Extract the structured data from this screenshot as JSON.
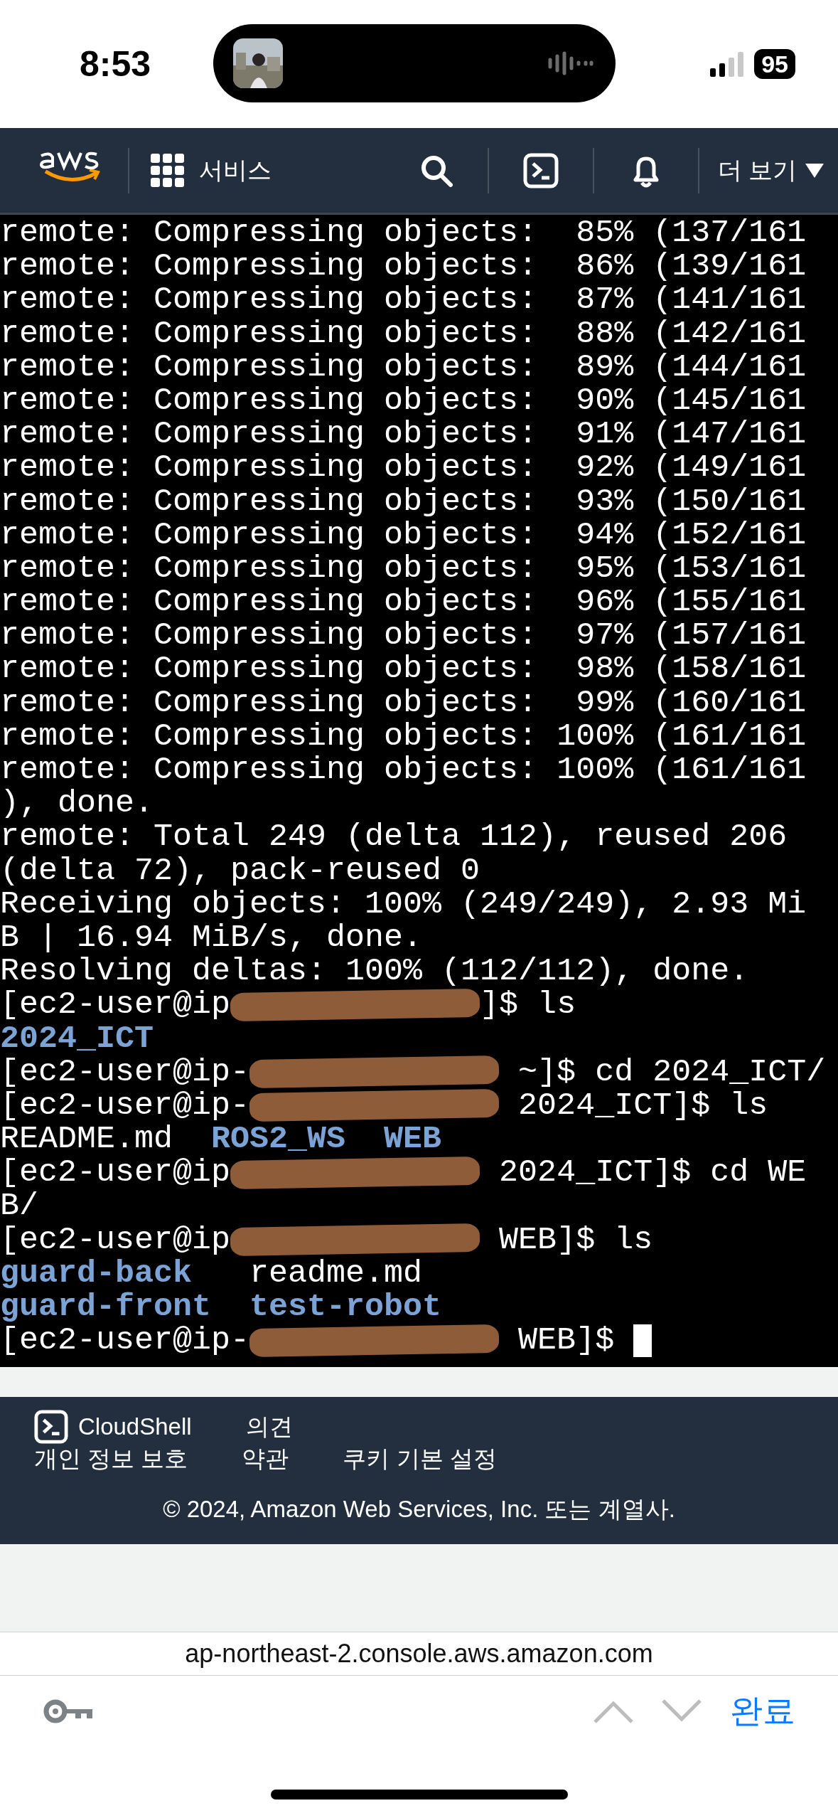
{
  "status_bar": {
    "time": "8:53",
    "battery": "95"
  },
  "nav": {
    "services": "서비스",
    "more": "더 보기"
  },
  "terminal": {
    "lines": [
      [
        {
          "kind": "plain",
          "text": "remote: Compressing objects:  85% (137/161"
        }
      ],
      [
        {
          "kind": "plain",
          "text": "remote: Compressing objects:  86% (139/161"
        }
      ],
      [
        {
          "kind": "plain",
          "text": "remote: Compressing objects:  87% (141/161"
        }
      ],
      [
        {
          "kind": "plain",
          "text": "remote: Compressing objects:  88% (142/161"
        }
      ],
      [
        {
          "kind": "plain",
          "text": "remote: Compressing objects:  89% (144/161"
        }
      ],
      [
        {
          "kind": "plain",
          "text": "remote: Compressing objects:  90% (145/161"
        }
      ],
      [
        {
          "kind": "plain",
          "text": "remote: Compressing objects:  91% (147/161"
        }
      ],
      [
        {
          "kind": "plain",
          "text": "remote: Compressing objects:  92% (149/161"
        }
      ],
      [
        {
          "kind": "plain",
          "text": "remote: Compressing objects:  93% (150/161"
        }
      ],
      [
        {
          "kind": "plain",
          "text": "remote: Compressing objects:  94% (152/161"
        }
      ],
      [
        {
          "kind": "plain",
          "text": "remote: Compressing objects:  95% (153/161"
        }
      ],
      [
        {
          "kind": "plain",
          "text": "remote: Compressing objects:  96% (155/161"
        }
      ],
      [
        {
          "kind": "plain",
          "text": "remote: Compressing objects:  97% (157/161"
        }
      ],
      [
        {
          "kind": "plain",
          "text": "remote: Compressing objects:  98% (158/161"
        }
      ],
      [
        {
          "kind": "plain",
          "text": "remote: Compressing objects:  99% (160/161"
        }
      ],
      [
        {
          "kind": "plain",
          "text": "remote: Compressing objects: 100% (161/161"
        }
      ],
      [
        {
          "kind": "plain",
          "text": "remote: Compressing objects: 100% (161/161"
        }
      ],
      [
        {
          "kind": "plain",
          "text": "), done."
        }
      ],
      [
        {
          "kind": "plain",
          "text": "remote: Total 249 (delta 112), reused 206"
        }
      ],
      [
        {
          "kind": "plain",
          "text": "(delta 72), pack-reused 0"
        }
      ],
      [
        {
          "kind": "plain",
          "text": "Receiving objects: 100% (249/249), 2.93 Mi"
        }
      ],
      [
        {
          "kind": "plain",
          "text": "B | 16.94 MiB/s, done."
        }
      ],
      [
        {
          "kind": "plain",
          "text": "Resolving deltas: 100% (112/112), done."
        }
      ],
      [
        {
          "kind": "plain",
          "text": "[ec2-user@ip"
        },
        {
          "kind": "redaction"
        },
        {
          "kind": "plain",
          "text": "]$ ls"
        }
      ],
      [
        {
          "kind": "dir",
          "text": "2024_ICT"
        }
      ],
      [
        {
          "kind": "plain",
          "text": "[ec2-user@ip-"
        },
        {
          "kind": "redaction"
        },
        {
          "kind": "plain",
          "text": " ~]$ cd 2024_ICT/"
        }
      ],
      [
        {
          "kind": "plain",
          "text": "[ec2-user@ip-"
        },
        {
          "kind": "redaction"
        },
        {
          "kind": "plain",
          "text": " 2024_ICT]$ ls"
        }
      ],
      [
        {
          "kind": "plain",
          "text": "README.md  "
        },
        {
          "kind": "dir",
          "text": "ROS2_WS  "
        },
        {
          "kind": "dir",
          "text": "WEB"
        }
      ],
      [
        {
          "kind": "plain",
          "text": "[ec2-user@ip"
        },
        {
          "kind": "redaction"
        },
        {
          "kind": "plain",
          "text": " 2024_ICT]$ cd WE"
        }
      ],
      [
        {
          "kind": "plain",
          "text": "B/"
        }
      ],
      [
        {
          "kind": "plain",
          "text": "[ec2-user@ip"
        },
        {
          "kind": "redaction"
        },
        {
          "kind": "plain",
          "text": " WEB]$ ls"
        }
      ],
      [
        {
          "kind": "dir",
          "text": "guard-back"
        },
        {
          "kind": "plain",
          "text": "   readme.md"
        }
      ],
      [
        {
          "kind": "dir",
          "text": "guard-front  "
        },
        {
          "kind": "dir",
          "text": "test-robot"
        }
      ],
      [
        {
          "kind": "plain",
          "text": "[ec2-user@ip-"
        },
        {
          "kind": "redaction"
        },
        {
          "kind": "plain",
          "text": " WEB]$ "
        },
        {
          "kind": "cursor"
        }
      ]
    ]
  },
  "footer": {
    "cloudshell": "CloudShell",
    "feedback": "의견",
    "links": [
      "개인 정보 보호",
      "약관",
      "쿠키 기본 설정"
    ],
    "copyright": "© 2024, Amazon Web Services, Inc. 또는 계열사."
  },
  "browser": {
    "url": "ap-northeast-2.console.aws.amazon.com",
    "done": "완료"
  }
}
